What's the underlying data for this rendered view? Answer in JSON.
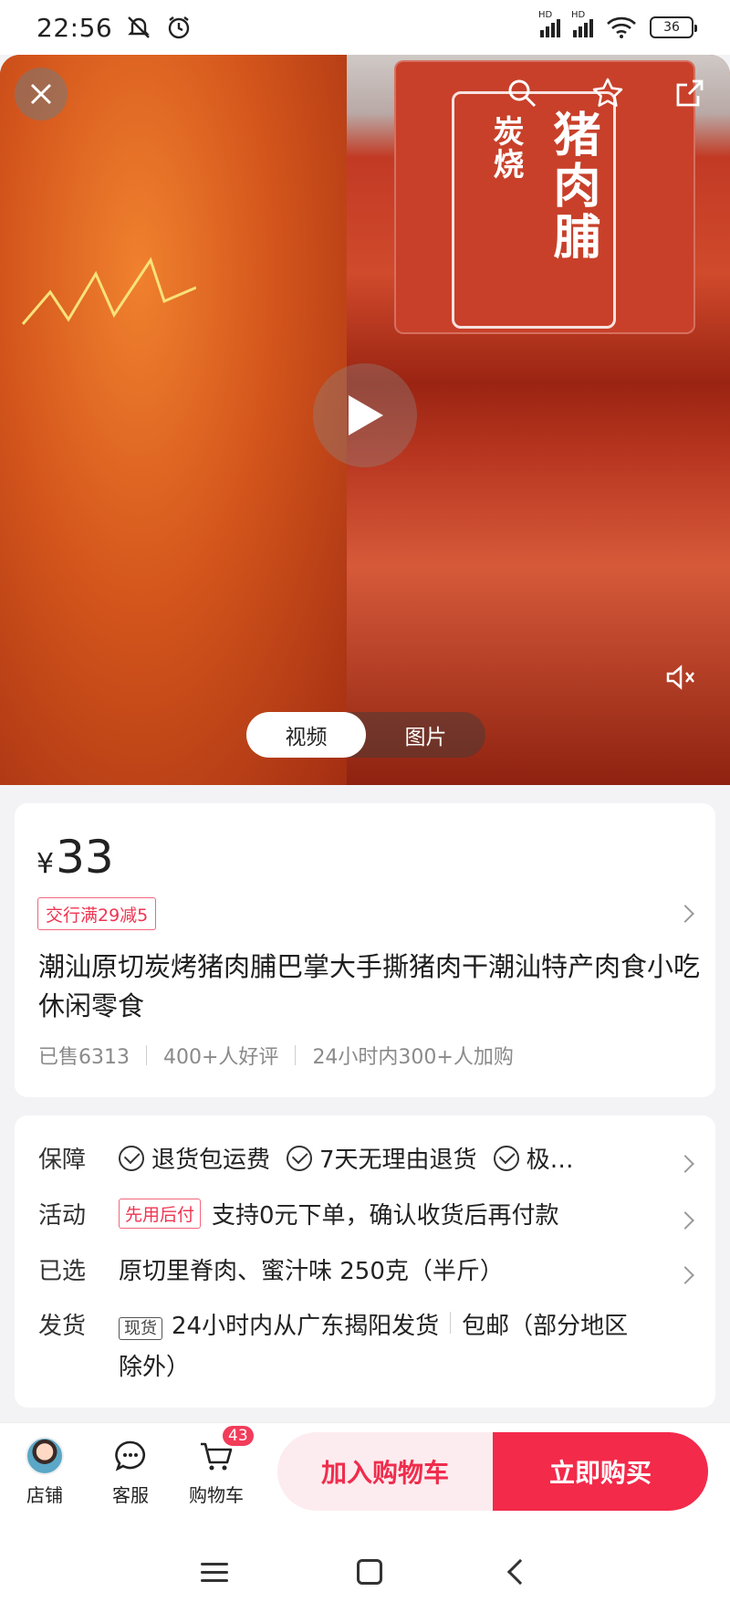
{
  "status_bar": {
    "time": "22:56",
    "icons_left": [
      "mute-icon",
      "alarm-icon"
    ],
    "icons_right": [
      "signal-hd-icon",
      "signal-hd-icon",
      "wifi-icon",
      "battery-icon"
    ],
    "battery": "36"
  },
  "hero": {
    "package_text_small": "炭烧",
    "package_text_big": "猪肉脯",
    "tabs": [
      {
        "label": "视频",
        "active": true
      },
      {
        "label": "图片",
        "active": false
      }
    ],
    "icons": [
      "close-icon",
      "search-icon",
      "star-icon",
      "share-icon",
      "play-icon",
      "mute-icon"
    ]
  },
  "product": {
    "currency": "¥",
    "price": "33",
    "promo_tag": "交行满29减5",
    "title": "潮汕原切炭烤猪肉脯巴掌大手撕猪肉干潮汕特产肉食小吃休闲零食",
    "stats": [
      "已售6313",
      "400+人好评",
      "24小时内300+人加购"
    ]
  },
  "details": {
    "guarantee": {
      "label": "保障",
      "items": [
        "退货包运费",
        "7天无理由退货",
        "极…"
      ]
    },
    "activity": {
      "label": "活动",
      "badge": "先用后付",
      "text": "支持0元下单，确认收货后再付款"
    },
    "selected": {
      "label": "已选",
      "text": "原切里脊肉、蜜汁味 250克（半斤）"
    },
    "shipping": {
      "label": "发货",
      "badge": "现货",
      "text_a": "24小时内从广东揭阳发货",
      "text_b": "包邮（部分地区除外）"
    }
  },
  "bottom_bar": {
    "store": "店铺",
    "service": "客服",
    "cart": "购物车",
    "cart_count": "43",
    "add_to_cart": "加入购物车",
    "buy_now": "立即购买"
  },
  "colors": {
    "accent": "#f32a4a",
    "accent_light": "#fdecef",
    "promo_border": "#f2677d"
  }
}
